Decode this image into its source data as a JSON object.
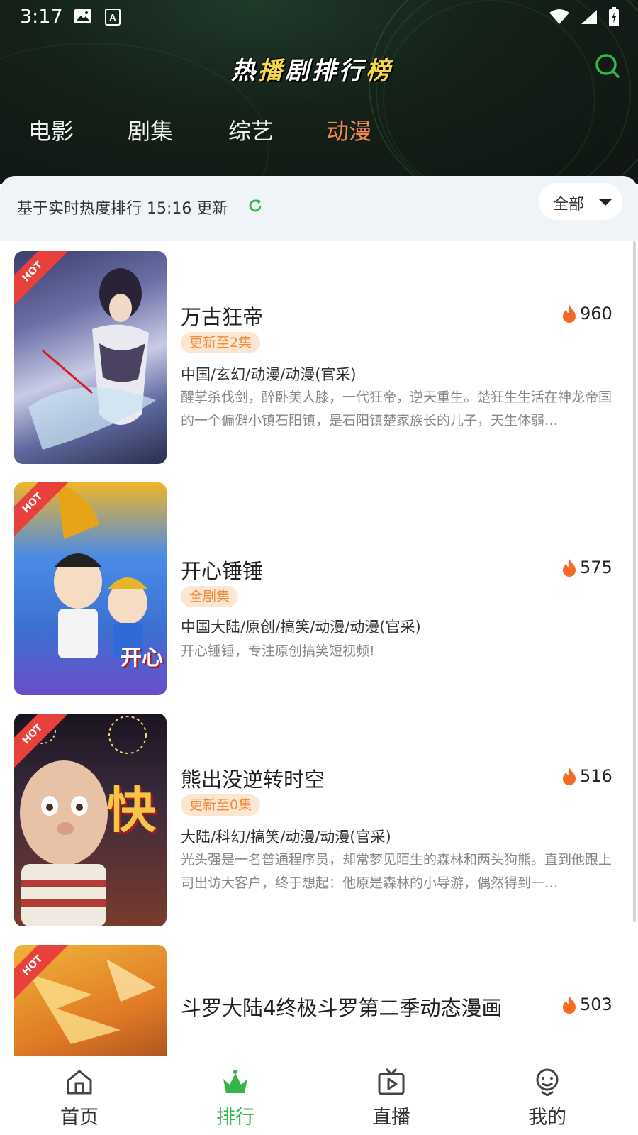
{
  "status_bar": {
    "time": "3:17"
  },
  "header": {
    "title_parts": [
      "热",
      "播",
      "剧",
      "排",
      "行",
      "榜"
    ],
    "tabs": [
      {
        "label": "电影",
        "active": false
      },
      {
        "label": "剧集",
        "active": false
      },
      {
        "label": "综艺",
        "active": false
      },
      {
        "label": "动漫",
        "active": true
      }
    ]
  },
  "info_bar": {
    "text": "基于实时热度排行 15:16 更新",
    "filter_label": "全部"
  },
  "items": [
    {
      "hot_label": "HOT",
      "title": "万古狂帝",
      "heat": "960",
      "badge": "更新至2集",
      "tags": "中国/玄幻/动漫/动漫(官采)",
      "desc": "醒掌杀伐剑，醉卧美人膝，一代狂帝，逆天重生。楚狂生生活在神龙帝国的一个偏僻小镇石阳镇，是石阳镇楚家族长的儿子，天生体弱…"
    },
    {
      "hot_label": "HOT",
      "title": "开心锤锤",
      "heat": "575",
      "badge": "全剧集",
      "tags": "中国大陆/原创/搞笑/动漫/动漫(官采)",
      "desc": "开心锤锤，专注原创搞笑短视频!"
    },
    {
      "hot_label": "HOT",
      "title": "熊出没逆转时空",
      "heat": "516",
      "badge": "更新至0集",
      "tags": "大陆/科幻/搞笑/动漫/动漫(官采)",
      "desc": "光头强是一名普通程序员，却常梦见陌生的森林和两头狗熊。直到他跟上司出访大客户，终于想起：他原是森林的小导游，偶然得到一…"
    },
    {
      "hot_label": "HOT",
      "title": "斗罗大陆4终极斗罗第二季动态漫画",
      "heat": "503",
      "badge": "",
      "tags": "",
      "desc": ""
    }
  ],
  "poster_text": {
    "item2": "开心",
    "item3": "快"
  },
  "bottom_nav": [
    {
      "label": "首页",
      "icon": "home-icon",
      "active": false
    },
    {
      "label": "排行",
      "icon": "crown-icon",
      "active": true
    },
    {
      "label": "直播",
      "icon": "tv-play-icon",
      "active": false
    },
    {
      "label": "我的",
      "icon": "profile-icon",
      "active": false
    }
  ],
  "colors": {
    "accent_green": "#36b54a",
    "accent_orange": "#f08a52",
    "hot_red": "#e8403a"
  }
}
